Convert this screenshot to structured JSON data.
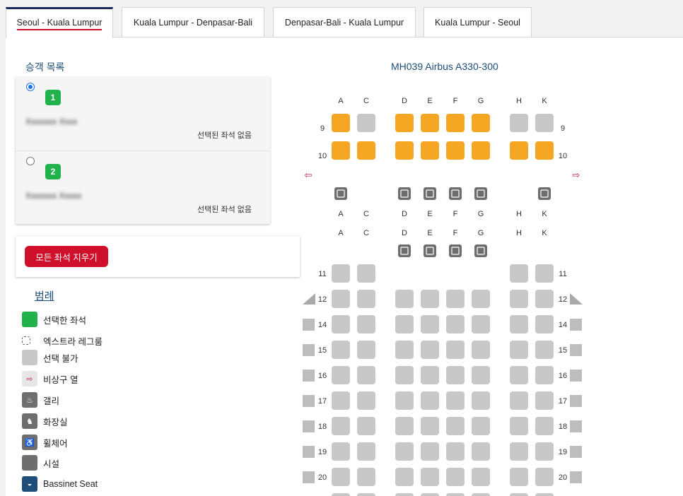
{
  "tabs": [
    {
      "label": "Seoul - Kuala Lumpur",
      "active": true
    },
    {
      "label": "Kuala Lumpur - Denpasar-Bali",
      "active": false
    },
    {
      "label": "Denpasar-Bali - Kuala Lumpur",
      "active": false
    },
    {
      "label": "Kuala Lumpur - Seoul",
      "active": false
    }
  ],
  "passenger_list": {
    "title": "승객 목록",
    "passengers": [
      {
        "number": "1",
        "name": "Xxxxxxx Xxxx",
        "seat_status": "선택된 좌석 없음",
        "selected": true
      },
      {
        "number": "2",
        "name": "Xxxxxxx Xxxxx",
        "seat_status": "선택된 좌석 없음",
        "selected": false
      }
    ]
  },
  "clear_button": "모든 좌석 지우기",
  "legend": {
    "title": "범례",
    "items": [
      {
        "label": "선택한 좌석",
        "icon": "selected-seat-swatch",
        "color": "#22b24c"
      },
      {
        "label": "엑스트라 레그룸",
        "icon": "extra-legroom-swatch",
        "color": "#ffffff"
      },
      {
        "label": "선택 불가",
        "icon": "unavailable-seat-swatch",
        "color": "#c8c8c8"
      },
      {
        "label": "비상구 열",
        "icon": "exit-row-icon",
        "color": "#e6e6e6"
      },
      {
        "label": "갤리",
        "icon": "galley-icon",
        "color": "#6e6e6e"
      },
      {
        "label": "화장실",
        "icon": "lavatory-icon",
        "color": "#6e6e6e"
      },
      {
        "label": "휠체어",
        "icon": "wheelchair-icon",
        "color": "#6e6e6e"
      },
      {
        "label": "시설",
        "icon": "facility-icon",
        "color": "#6e6e6e"
      },
      {
        "label": "Bassinet Seat",
        "icon": "bassinet-icon",
        "color": "#1e4e79"
      }
    ]
  },
  "seatmap": {
    "aircraft": "MH039 Airbus A330-300",
    "business_columns": [
      "A",
      "C",
      "D",
      "E",
      "F",
      "G",
      "H",
      "K"
    ],
    "business_rows": [
      {
        "row": "9",
        "premium_seats": [
          "A",
          "D",
          "E",
          "F",
          "G"
        ],
        "unavailable_seats": [
          "C",
          "H",
          "K"
        ]
      },
      {
        "row": "10",
        "premium_seats": [
          "A",
          "C",
          "D",
          "E",
          "F",
          "G",
          "H",
          "K"
        ],
        "unavailable_seats": []
      }
    ],
    "economy_columns": [
      "A",
      "C",
      "D",
      "E",
      "F",
      "G",
      "H",
      "K"
    ],
    "economy_rows": [
      "11",
      "12",
      "14",
      "15",
      "16",
      "17",
      "18",
      "19",
      "20"
    ],
    "colors": {
      "premium": "#f5a623",
      "unavailable": "#c8c8c8",
      "facility": "#6e6e6e",
      "exit": "#c2185b"
    }
  }
}
